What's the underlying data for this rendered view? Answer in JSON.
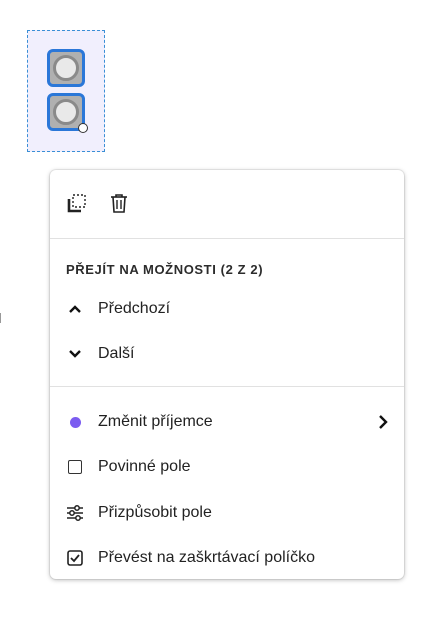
{
  "field": {
    "widgets": [
      "radio-option-1",
      "radio-option-2"
    ]
  },
  "menu": {
    "toolbar": {
      "icons": [
        "duplicate-icon",
        "trash-icon"
      ]
    },
    "navigate": {
      "title": "PŘEJÍT NA MOŽNOSTI (2 Z 2)",
      "previous_label": "Předchozí",
      "next_label": "Další"
    },
    "items": {
      "change_recipient_label": "Změnit příjemce",
      "recipient_color": "#7b5cf0",
      "required_label": "Povinné pole",
      "customize_label": "Přizpůsobit pole",
      "convert_label": "Převést na zaškrtávací políčko"
    }
  }
}
